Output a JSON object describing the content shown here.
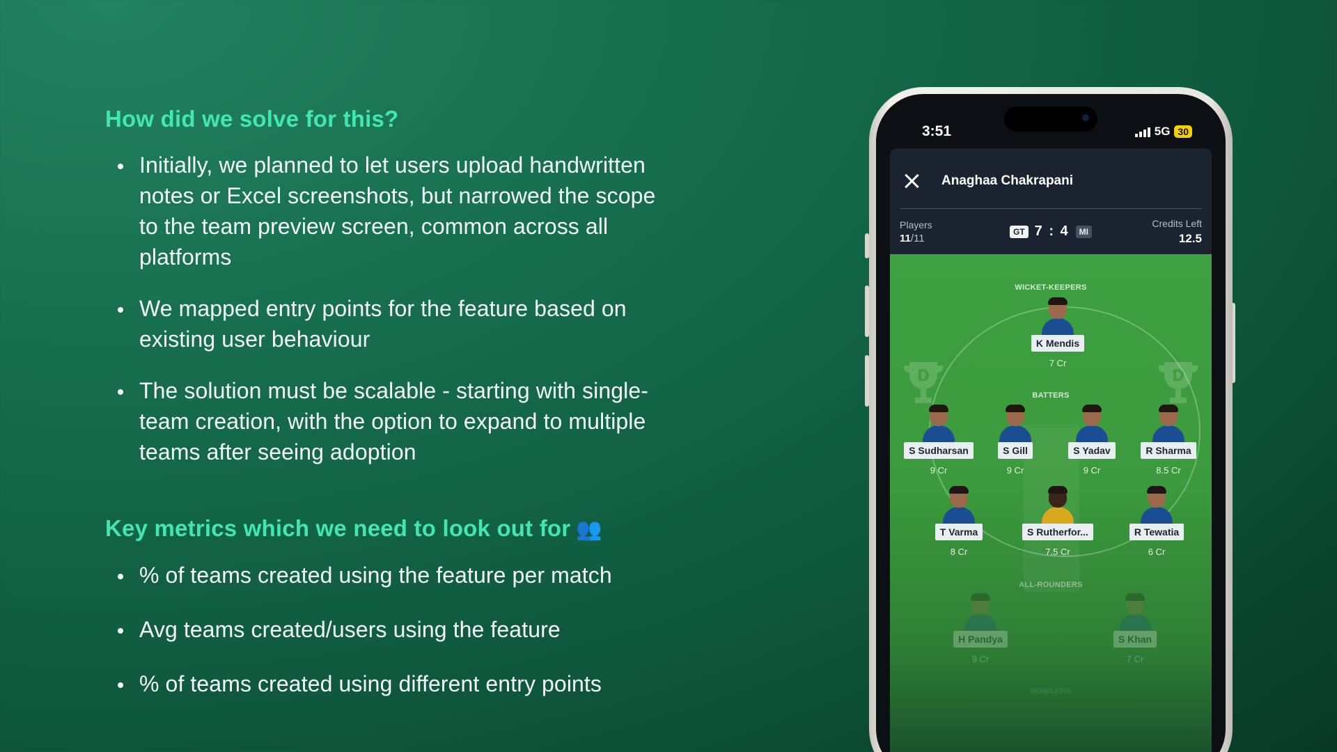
{
  "slide": {
    "heading_1": "How did we solve for this?",
    "points_1": [
      "Initially, we planned to let users upload handwritten notes or Excel screenshots, but narrowed the scope to the team preview screen, common across all platforms",
      "We mapped entry points for the feature based on existing user behaviour",
      "The solution must be scalable - starting with single-team creation, with the option to expand to multiple teams after seeing adoption"
    ],
    "heading_2": "Key metrics which we need to look out for",
    "heading_2_emoji": "👥",
    "points_2": [
      "% of teams created using the feature per match",
      "Avg teams created/users using the feature",
      "% of teams created using different entry points"
    ]
  },
  "phone": {
    "status": {
      "time": "3:51",
      "network": "5G",
      "battery": "30"
    },
    "header": {
      "user_name": "Anaghaa Chakrapani",
      "players_label": "Players",
      "players_count": "11",
      "players_total": "/11",
      "team_a": "GT",
      "score": "7 : 4",
      "team_b": "MI",
      "credits_label": "Credits Left",
      "credits_value": "12.5"
    },
    "sections": {
      "wicket_keepers": "WICKET-KEEPERS",
      "batters": "BATTERS",
      "all_rounders": "ALL-ROUNDERS",
      "bowlers": "BOWLERS"
    },
    "players": {
      "wk": [
        {
          "name": "K Mendis",
          "credit": "7 Cr"
        }
      ],
      "bat_row1": [
        {
          "name": "S Sudharsan",
          "credit": "9 Cr"
        },
        {
          "name": "S Gill",
          "credit": "9 Cr"
        },
        {
          "name": "S Yadav",
          "credit": "9 Cr"
        },
        {
          "name": "R Sharma",
          "credit": "8.5 Cr"
        }
      ],
      "bat_row2": [
        {
          "name": "T Varma",
          "credit": "8 Cr"
        },
        {
          "name": "S Rutherfor...",
          "credit": "7.5 Cr"
        },
        {
          "name": "R Tewatia",
          "credit": "6 Cr"
        }
      ],
      "ar": [
        {
          "name": "H Pandya",
          "credit": "9 Cr"
        },
        {
          "name": "S Khan",
          "credit": "7 Cr"
        }
      ]
    },
    "colors": {
      "accent": "#41e6b0",
      "pitch": "#3ea040",
      "header_bg": "#1c2330"
    },
    "icons": [
      "close-icon",
      "signal-icon",
      "battery-icon",
      "trophy-icon",
      "player-avatar"
    ]
  }
}
